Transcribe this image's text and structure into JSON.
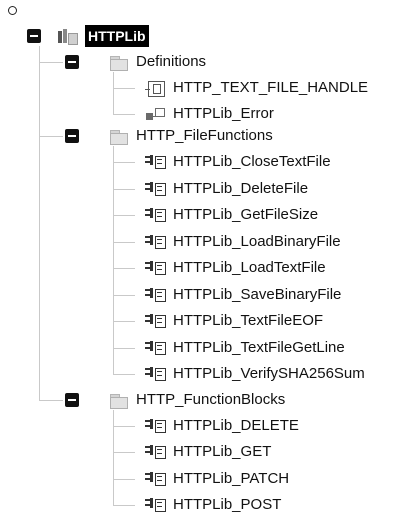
{
  "tree": {
    "root": {
      "label": "HTTPLib",
      "icon": "library-icon"
    },
    "groups": [
      {
        "label": "Definitions",
        "icon": "folder-icon",
        "items": [
          {
            "label": "HTTP_TEXT_FILE_HANDLE",
            "icon": "handle-icon"
          },
          {
            "label": "HTTPLib_Error",
            "icon": "error-type-icon"
          }
        ]
      },
      {
        "label": "HTTP_FileFunctions",
        "icon": "folder-icon",
        "items": [
          {
            "label": "HTTPLib_CloseTextFile",
            "icon": "function-icon"
          },
          {
            "label": "HTTPLib_DeleteFile",
            "icon": "function-icon"
          },
          {
            "label": "HTTPLib_GetFileSize",
            "icon": "function-icon"
          },
          {
            "label": "HTTPLib_LoadBinaryFile",
            "icon": "function-icon"
          },
          {
            "label": "HTTPLib_LoadTextFile",
            "icon": "function-icon"
          },
          {
            "label": "HTTPLib_SaveBinaryFile",
            "icon": "function-icon"
          },
          {
            "label": "HTTPLib_TextFileEOF",
            "icon": "function-icon"
          },
          {
            "label": "HTTPLib_TextFileGetLine",
            "icon": "function-icon"
          },
          {
            "label": "HTTPLib_VerifySHA256Sum",
            "icon": "function-icon"
          }
        ]
      },
      {
        "label": "HTTP_FunctionBlocks",
        "icon": "folder-icon",
        "items": [
          {
            "label": "HTTPLib_DELETE",
            "icon": "function-block-icon"
          },
          {
            "label": "HTTPLib_GET",
            "icon": "function-block-icon"
          },
          {
            "label": "HTTPLib_PATCH",
            "icon": "function-block-icon"
          },
          {
            "label": "HTTPLib_POST",
            "icon": "function-block-icon"
          }
        ]
      }
    ]
  }
}
